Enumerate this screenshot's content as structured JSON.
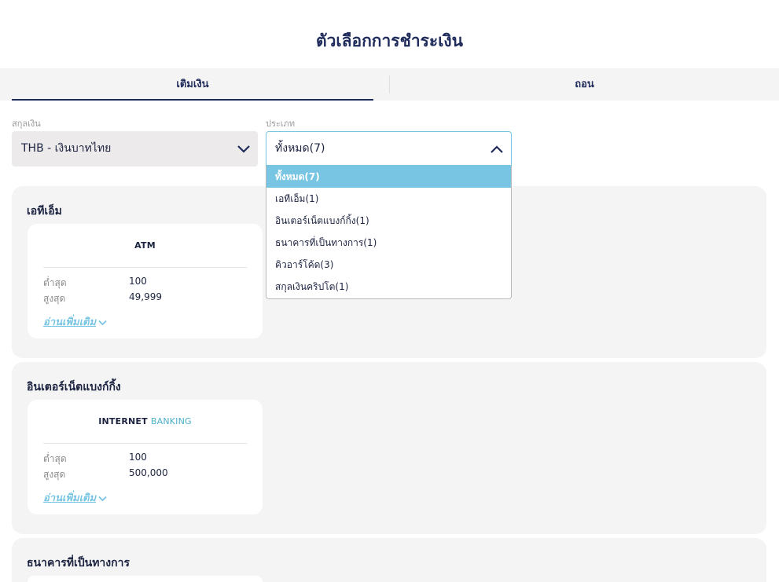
{
  "page": {
    "title": "ตัวเลือกการชำระเงิน"
  },
  "tabs": [
    {
      "label": "เติมเงิน",
      "active": true
    },
    {
      "label": "ถอน",
      "active": false
    }
  ],
  "filters": {
    "currency": {
      "label": "สกุลเงิน",
      "value": "THB - เงินบาทไทย"
    },
    "type": {
      "label": "ประเภท",
      "value": "ทั้งหมด(7)",
      "options": [
        "ทั้งหมด(7)",
        "เอทีเอ็ม(1)",
        "อินเตอร์เน็ตแบงก์กิ้ง(1)",
        "ธนาคารที่เป็นทางการ(1)",
        "คิวอาร์โค้ด(3)",
        "สกุลเงินคริปโต(1)"
      ]
    }
  },
  "sections": [
    {
      "title": "เอทีเอ็ม",
      "card": {
        "logo": "ATM",
        "logo_accent": "",
        "min_label": "ต่ำสุด",
        "min_value": "100",
        "max_label": "สูงสุด",
        "max_value": "49,999",
        "read_more": "อ่านเพิ่มเติม"
      }
    },
    {
      "title": "อินเตอร์เน็ตแบงก์กิ้ง",
      "card": {
        "logo": "INTERNET",
        "logo_accent": "BANKING",
        "min_label": "ต่ำสุด",
        "min_value": "100",
        "max_label": "สูงสุด",
        "max_value": "500,000",
        "read_more": "อ่านเพิ่มเติม"
      }
    },
    {
      "title": "ธนาคารที่เป็นทางการ"
    }
  ],
  "colors": {
    "accent": "#78c5e3",
    "navy": "#1f2b5b",
    "panel": "#f4f4f4"
  }
}
